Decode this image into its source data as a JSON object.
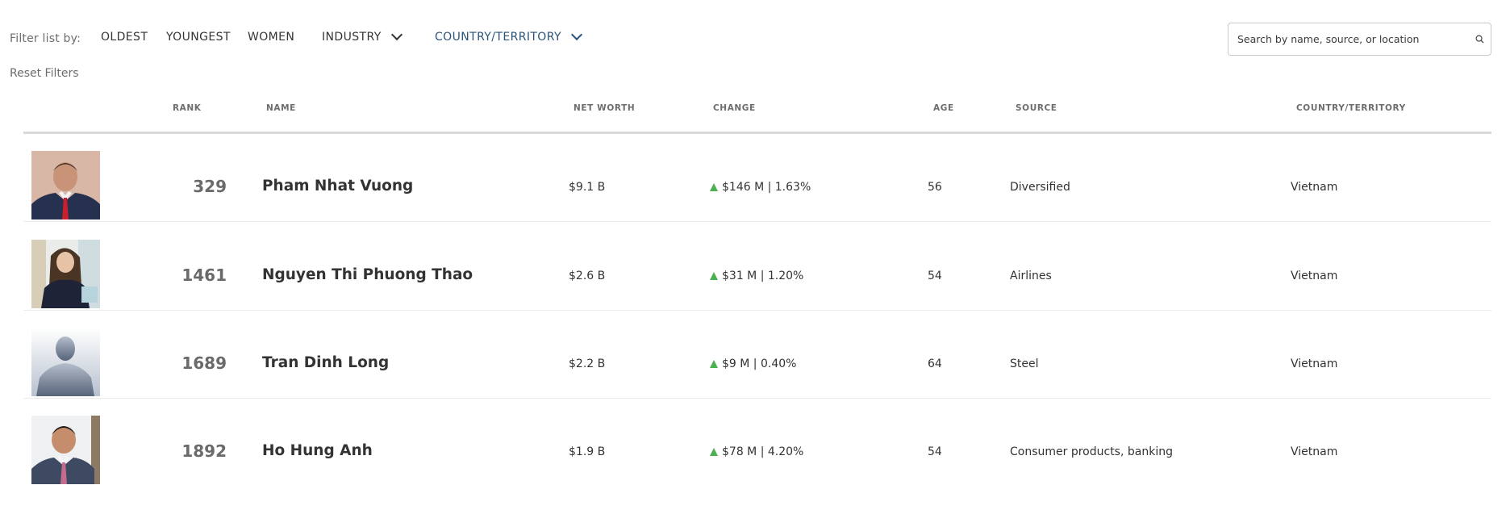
{
  "filters": {
    "label": "Filter list by:",
    "options": [
      {
        "label": "OLDEST",
        "active": false,
        "dropdown": false
      },
      {
        "label": "YOUNGEST",
        "active": false,
        "dropdown": false
      },
      {
        "label": "WOMEN",
        "active": false,
        "dropdown": false
      },
      {
        "label": "INDUSTRY",
        "active": false,
        "dropdown": true
      },
      {
        "label": "COUNTRY/TERRITORY",
        "active": true,
        "dropdown": true
      }
    ],
    "reset_label": "Reset Filters",
    "active_color": "#2b5278"
  },
  "search": {
    "placeholder": "Search by name, source, or location",
    "value": ""
  },
  "table": {
    "headers": {
      "rank": "RANK",
      "name": "NAME",
      "net_worth": "NET WORTH",
      "change": "CHANGE",
      "age": "AGE",
      "source": "SOURCE",
      "country": "COUNTRY/TERRITORY"
    },
    "rows": [
      {
        "photo": "portrait-man-suit-red-tie",
        "rank": "329",
        "name": "Pham Nhat Vuong",
        "net_worth": "$9.1 B",
        "change": "$146 M | 1.63%",
        "change_dir": "up",
        "age": "56",
        "source": "Diversified",
        "country": "Vietnam"
      },
      {
        "photo": "portrait-woman-dark-dress",
        "rank": "1461",
        "name": "Nguyen Thi Phuong Thao",
        "net_worth": "$2.6 B",
        "change": "$31 M | 1.20%",
        "change_dir": "up",
        "age": "54",
        "source": "Airlines",
        "country": "Vietnam"
      },
      {
        "photo": "placeholder-silhouette",
        "rank": "1689",
        "name": "Tran Dinh Long",
        "net_worth": "$2.2 B",
        "change": "$9 M | 0.40%",
        "change_dir": "up",
        "age": "64",
        "source": "Steel",
        "country": "Vietnam"
      },
      {
        "photo": "portrait-man-suit-pink-tie",
        "rank": "1892",
        "name": "Ho Hung Anh",
        "net_worth": "$1.9 B",
        "change": "$78 M | 4.20%",
        "change_dir": "up",
        "age": "54",
        "source": "Consumer products, banking",
        "country": "Vietnam"
      }
    ],
    "up_color": "#4caf50"
  }
}
